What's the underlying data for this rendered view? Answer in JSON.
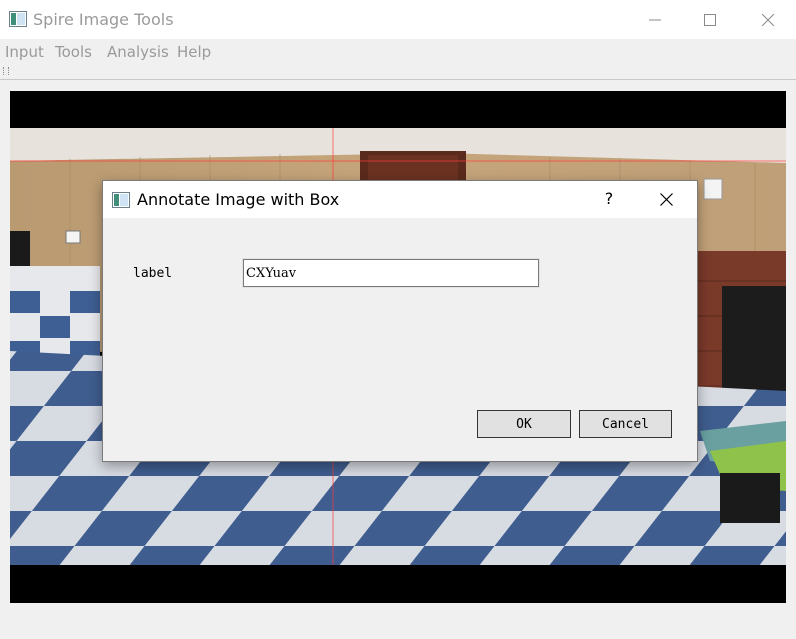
{
  "window": {
    "title": "Spire Image Tools",
    "controls": {
      "minimize": "minimize",
      "maximize": "maximize",
      "close": "close"
    }
  },
  "menu": {
    "items": [
      {
        "label": "Input"
      },
      {
        "label": "Tools"
      },
      {
        "label": "Analysis"
      },
      {
        "label": "Help"
      }
    ]
  },
  "dialog": {
    "title": "Annotate Image with Box",
    "help_label": "?",
    "field_label": "label",
    "field_value": "CXYuav",
    "ok_label": "OK",
    "cancel_label": "Cancel"
  },
  "colors": {
    "title_inactive": "#9a9a9a",
    "focus_border": "#0078d7",
    "crosshair": "#ff3b3b"
  },
  "icons": [
    "app-icon",
    "minimize-icon",
    "maximize-icon",
    "close-icon",
    "help-icon",
    "dialog-close-icon"
  ]
}
